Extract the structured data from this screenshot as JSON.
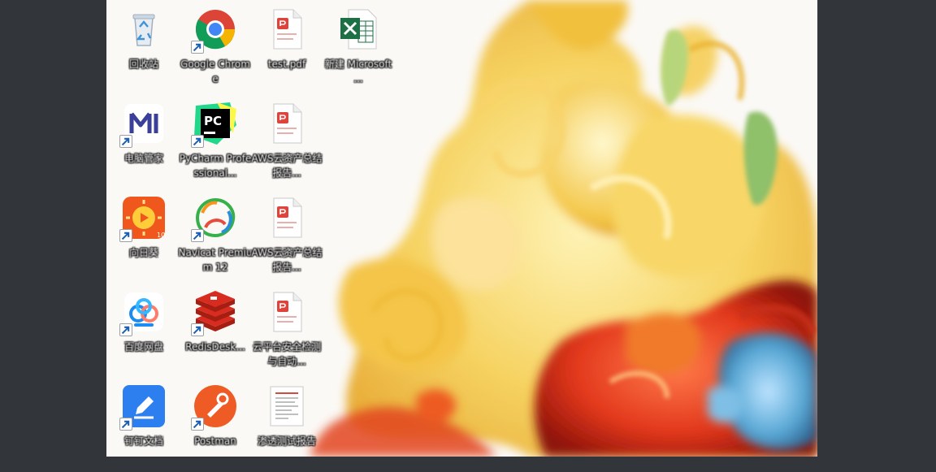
{
  "desktop": {
    "icons": [
      {
        "label": "回收站",
        "icon": "recycle-bin-icon"
      },
      {
        "label": "Google Chrome",
        "icon": "chrome-icon"
      },
      {
        "label": "test.pdf",
        "icon": "pdf-file-icon"
      },
      {
        "label": "新建 Microsoft ...",
        "icon": "excel-icon"
      },
      {
        "label": "电脑管家",
        "icon": "m-logo-icon"
      },
      {
        "label": "PyCharm Professional...",
        "icon": "pycharm-icon"
      },
      {
        "label": "AWS云资产总结报告...",
        "icon": "pdf-file-icon"
      },
      {
        "label": "向日葵",
        "icon": "sunflower-icon"
      },
      {
        "label": "Navicat Premium 12",
        "icon": "navicat-icon"
      },
      {
        "label": "AWS云资产总结报告...",
        "icon": "pdf-file-icon"
      },
      {
        "label": "百度网盘",
        "icon": "baidu-netdisk-icon"
      },
      {
        "label": "RedisDesk...",
        "icon": "redis-icon"
      },
      {
        "label": "云平台安全检测与自动...",
        "icon": "pdf-file-icon"
      },
      {
        "label": "钉钉文档",
        "icon": "docs-pen-icon"
      },
      {
        "label": "Postman",
        "icon": "postman-icon"
      },
      {
        "label": "渗透测试报告",
        "icon": "document-icon"
      }
    ]
  },
  "colors": {
    "frame": "#323539",
    "desktop_bg": "#fbf9f6"
  }
}
